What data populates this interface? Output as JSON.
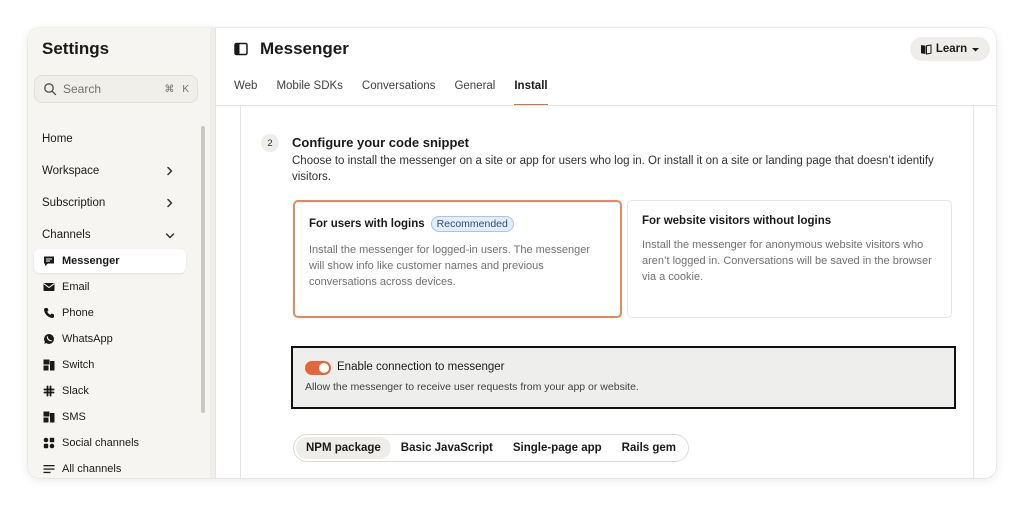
{
  "sidebar": {
    "title": "Settings",
    "search": {
      "placeholder": "Search",
      "shortcut_cmd": "⌘",
      "shortcut_key": "K"
    },
    "sections": [
      {
        "label": "Home"
      },
      {
        "label": "Workspace"
      },
      {
        "label": "Subscription"
      },
      {
        "label": "Channels"
      }
    ],
    "channels": [
      {
        "label": "Messenger",
        "icon": "messenger-icon"
      },
      {
        "label": "Email",
        "icon": "email-icon"
      },
      {
        "label": "Phone",
        "icon": "phone-icon"
      },
      {
        "label": "WhatsApp",
        "icon": "whatsapp-icon"
      },
      {
        "label": "Switch",
        "icon": "switch-icon"
      },
      {
        "label": "Slack",
        "icon": "slack-icon"
      },
      {
        "label": "SMS",
        "icon": "sms-icon"
      },
      {
        "label": "Social channels",
        "icon": "social-channels-icon"
      },
      {
        "label": "All channels",
        "icon": "all-channels-icon"
      }
    ]
  },
  "header": {
    "title": "Messenger",
    "learn_label": "Learn"
  },
  "tabs": [
    {
      "label": "Web"
    },
    {
      "label": "Mobile SDKs"
    },
    {
      "label": "Conversations"
    },
    {
      "label": "General"
    },
    {
      "label": "Install"
    }
  ],
  "section": {
    "step": "2",
    "title": "Configure your code snippet",
    "description": "Choose to install the messenger on a site or app for users who log in. Or install it on a site or landing page that doesn’t identify visitors."
  },
  "options": [
    {
      "title": "For users with logins",
      "badge": "Recommended",
      "description": "Install the messenger for logged-in users. The messenger will show info like customer names and previous conversations across devices."
    },
    {
      "title": "For website visitors without logins",
      "description": "Install the messenger for anonymous website visitors who aren’t logged in. Conversations will be saved in the browser via a cookie."
    }
  ],
  "connection": {
    "label": "Enable connection to messenger",
    "description": "Allow the messenger to receive user requests from your app or website.",
    "enabled": true
  },
  "install_methods": [
    {
      "label": "NPM package"
    },
    {
      "label": "Basic JavaScript"
    },
    {
      "label": "Single-page app"
    },
    {
      "label": "Rails gem"
    }
  ],
  "colors": {
    "accent": "#e3673a",
    "sidebar_bg": "#f6f5f1",
    "badge_bg": "#e3edfb"
  }
}
